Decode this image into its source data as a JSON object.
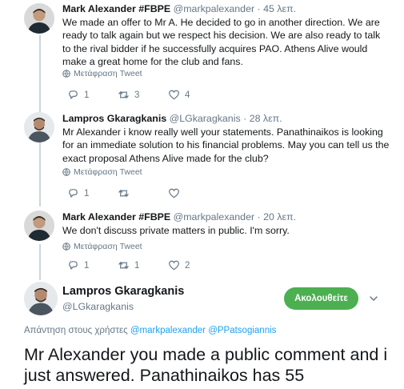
{
  "thread": [
    {
      "name": "Mark Alexander #FBPE",
      "handle": "@markpalexander",
      "separator": "·",
      "time": "45 λεπ.",
      "text": "We made an offer to Mr A. He decided to go in another direction. We are ready to talk again but we respect his decision. We are also ready to talk to the rival bidder if he successfully acquires PAO. Athens Alive would make a great home for the club and fans.",
      "translate": "Μετάφραση Tweet",
      "replies": "1",
      "retweets": "3",
      "likes": "4"
    },
    {
      "name": "Lampros Gkaragkanis",
      "handle": "@LGkaragkanis",
      "separator": "·",
      "time": "28 λεπ.",
      "text": "Mr Alexander i know really well your statements. Panathinaikos is looking for an immediate solution to his financial problems. May you can tell us the exact proposal Athens Alive made for the club?",
      "translate": "Μετάφραση Tweet",
      "replies": "1",
      "retweets": "",
      "likes": ""
    },
    {
      "name": "Mark Alexander #FBPE",
      "handle": "@markpalexander",
      "separator": "·",
      "time": "20 λεπ.",
      "text": "We don't discuss private matters in public. I'm sorry.",
      "translate": "Μετάφραση Tweet",
      "replies": "1",
      "retweets": "1",
      "likes": "2"
    }
  ],
  "main_tweet": {
    "name": "Lampros Gkaragkanis",
    "handle": "@LGkaragkanis",
    "follow_label": "Ακολουθείτε",
    "reply_prefix": "Απάντηση στους χρήστες",
    "mention1": "@markpalexander",
    "mention2": "@PPatsogiannis",
    "text": "Mr Alexander you made a public comment and i just answered. Panathinaikos has 55"
  },
  "colors": {
    "follow_button": "#4caf50",
    "link": "#1da1f2",
    "muted": "#657786",
    "thread_line": "#ccd6dd"
  },
  "icons": [
    "reply-icon",
    "retweet-icon",
    "like-icon",
    "globe-icon",
    "chevron-down-icon"
  ]
}
